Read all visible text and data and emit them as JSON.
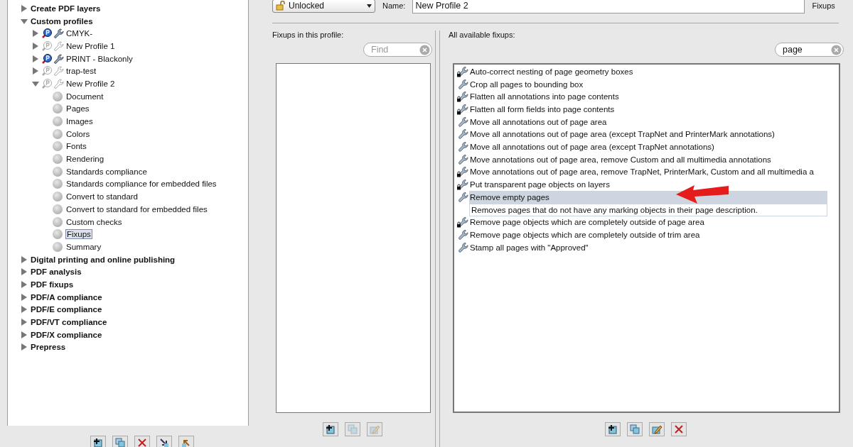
{
  "tree": [
    {
      "label": "Create PDF layers",
      "expanded": false
    },
    {
      "label": "Custom profiles",
      "expanded": true,
      "children": [
        {
          "label": "CMYK-",
          "kind": "profile",
          "active": true,
          "expanded": false
        },
        {
          "label": "New Profile 1",
          "kind": "profile",
          "active": false,
          "expanded": false
        },
        {
          "label": "PRINT - Blackonly",
          "kind": "profile",
          "active": true,
          "expanded": false
        },
        {
          "label": "trap-test",
          "kind": "profile",
          "active": false,
          "expanded": false
        },
        {
          "label": "New Profile 2",
          "kind": "profile",
          "active": false,
          "expanded": true,
          "children": [
            {
              "label": "Document",
              "kind": "section",
              "selected": false
            },
            {
              "label": "Pages",
              "kind": "section",
              "selected": false
            },
            {
              "label": "Images",
              "kind": "section",
              "selected": false
            },
            {
              "label": "Colors",
              "kind": "section",
              "selected": false
            },
            {
              "label": "Fonts",
              "kind": "section",
              "selected": false
            },
            {
              "label": "Rendering",
              "kind": "section",
              "selected": false
            },
            {
              "label": "Standards compliance",
              "kind": "section",
              "selected": false
            },
            {
              "label": "Standards compliance for embedded files",
              "kind": "section",
              "selected": false
            },
            {
              "label": "Convert to standard",
              "kind": "section",
              "selected": false
            },
            {
              "label": "Convert to standard for embedded files",
              "kind": "section",
              "selected": false
            },
            {
              "label": "Custom checks",
              "kind": "section",
              "selected": false
            },
            {
              "label": "Fixups",
              "kind": "section",
              "selected": true
            },
            {
              "label": "Summary",
              "kind": "section",
              "selected": false
            }
          ]
        }
      ]
    },
    {
      "label": "Digital printing and online publishing",
      "expanded": false
    },
    {
      "label": "PDF analysis",
      "expanded": false
    },
    {
      "label": "PDF fixups",
      "expanded": false
    },
    {
      "label": "PDF/A compliance",
      "expanded": false
    },
    {
      "label": "PDF/E compliance",
      "expanded": false
    },
    {
      "label": "PDF/VT compliance",
      "expanded": false
    },
    {
      "label": "PDF/X compliance",
      "expanded": false
    },
    {
      "label": "Prepress",
      "expanded": false
    }
  ],
  "lock_dropdown": {
    "value": "Unlocked"
  },
  "name_field": {
    "label": "Name:",
    "value": "New Profile 2"
  },
  "side_label": "Fixups",
  "profile_fixups": {
    "label": "Fixups in this profile:",
    "search": {
      "placeholder": "Find"
    }
  },
  "available_fixups": {
    "label": "All available fixups:",
    "search": {
      "value": "page"
    },
    "items": [
      {
        "label": "Auto-correct nesting of page geometry boxes",
        "locked": true,
        "selected": false
      },
      {
        "label": "Crop all pages to bounding box",
        "locked": false,
        "selected": false
      },
      {
        "label": "Flatten all annotations into page contents",
        "locked": true,
        "selected": false
      },
      {
        "label": "Flatten all form fields into page contents",
        "locked": true,
        "selected": false
      },
      {
        "label": "Move all annotations out of page area",
        "locked": false,
        "selected": false
      },
      {
        "label": "Move all annotations out of page area (except TrapNet and PrinterMark annotations)",
        "locked": false,
        "selected": false
      },
      {
        "label": "Move all annotations out of page area (except TrapNet annotations)",
        "locked": false,
        "selected": false
      },
      {
        "label": "Move annotations out of page area, remove Custom and all multimedia annotations",
        "locked": false,
        "selected": false
      },
      {
        "label": "Move annotations out of page area, remove TrapNet, PrinterMark, Custom and all multimedia a",
        "locked": true,
        "selected": false
      },
      {
        "label": "Put transparent page objects on layers",
        "locked": true,
        "selected": false
      },
      {
        "label": "Remove empty pages",
        "locked": false,
        "selected": true,
        "description": "Removes pages that do not have any marking objects in their page description."
      },
      {
        "label": "Remove page objects which are completely outside of page area",
        "locked": true,
        "selected": false
      },
      {
        "label": "Remove page objects which are completely outside of trim area",
        "locked": false,
        "selected": false
      },
      {
        "label": "Stamp all pages with \"Approved\"",
        "locked": false,
        "selected": false
      }
    ]
  }
}
